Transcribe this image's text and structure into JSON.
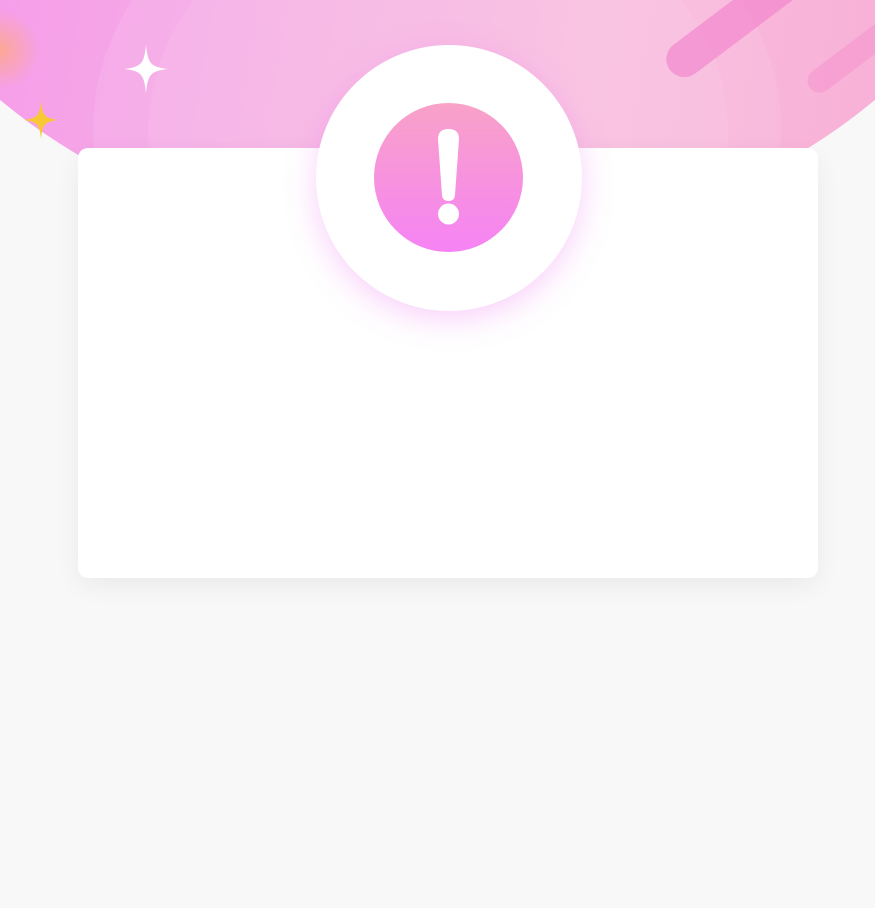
{
  "header": {
    "title": "",
    "background_colors": [
      "#f48ef0",
      "#f9badd",
      "#f8acd4"
    ]
  },
  "decorations": {
    "sparkle_white": {
      "icon": "four-point-star-icon",
      "color": "#ffffff"
    },
    "sparkle_yellow": {
      "icon": "four-point-star-icon",
      "color": "#f9c935"
    }
  },
  "alert": {
    "icon": "exclamation-icon",
    "gradient": [
      "#f8a2c8",
      "#f683f4"
    ]
  },
  "card": {
    "message": ""
  }
}
